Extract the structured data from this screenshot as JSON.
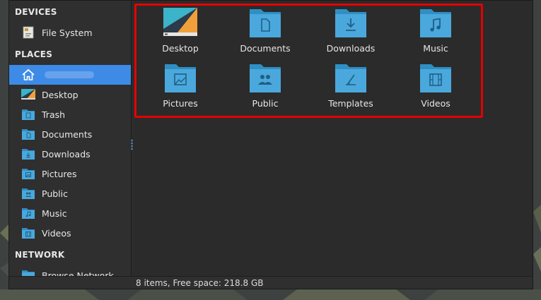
{
  "sidebar": {
    "devices_title": "DEVICES",
    "devices": [
      {
        "label": "File System",
        "icon": "drive-icon"
      }
    ],
    "places_title": "PLACES",
    "places": [
      {
        "label": "",
        "icon": "home-icon",
        "active": true
      },
      {
        "label": "Desktop",
        "icon": "desktop-icon"
      },
      {
        "label": "Trash",
        "icon": "trash-icon"
      },
      {
        "label": "Documents",
        "icon": "documents-folder-icon"
      },
      {
        "label": "Downloads",
        "icon": "downloads-folder-icon"
      },
      {
        "label": "Pictures",
        "icon": "pictures-folder-icon"
      },
      {
        "label": "Public",
        "icon": "public-folder-icon"
      },
      {
        "label": "Music",
        "icon": "music-folder-icon"
      },
      {
        "label": "Videos",
        "icon": "videos-folder-icon"
      }
    ],
    "network_title": "NETWORK",
    "network": [
      {
        "label": "Browse Network",
        "icon": "network-folder-icon"
      }
    ]
  },
  "main": {
    "items": [
      {
        "label": "Desktop",
        "icon": "desktop-icon"
      },
      {
        "label": "Documents",
        "icon": "documents-folder-icon"
      },
      {
        "label": "Downloads",
        "icon": "downloads-folder-icon"
      },
      {
        "label": "Music",
        "icon": "music-folder-icon"
      },
      {
        "label": "Pictures",
        "icon": "pictures-folder-icon"
      },
      {
        "label": "Public",
        "icon": "public-folder-icon"
      },
      {
        "label": "Templates",
        "icon": "templates-folder-icon"
      },
      {
        "label": "Videos",
        "icon": "videos-folder-icon"
      }
    ]
  },
  "status": {
    "text": "8 items, Free space: 218.8 GB"
  },
  "colors": {
    "accent": "#3d8be6",
    "folder": "#4aa8dc",
    "selection_border": "#e50000"
  }
}
